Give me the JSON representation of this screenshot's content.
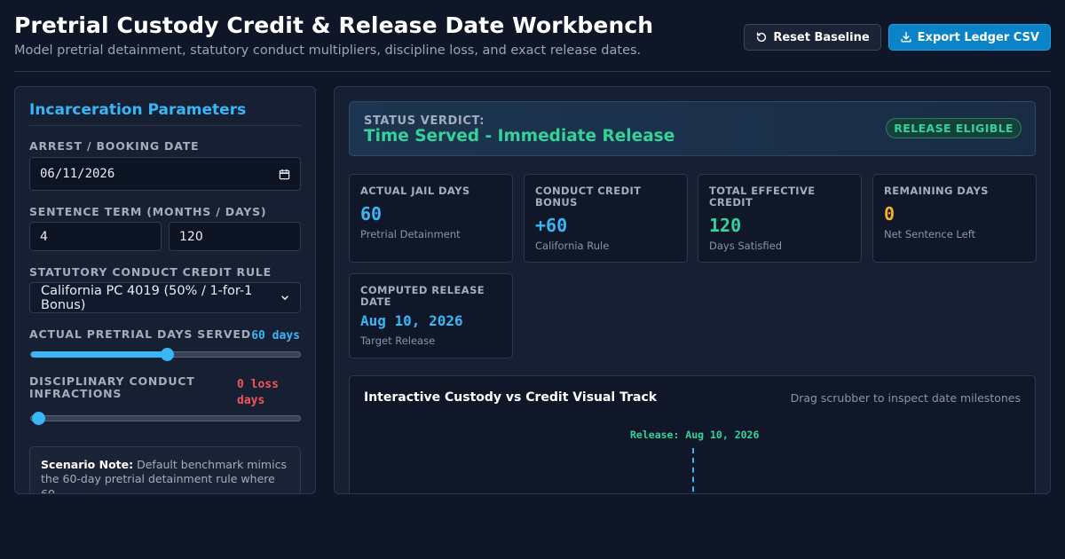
{
  "header": {
    "title": "Pretrial Custody Credit & Release Date Workbench",
    "subtitle": "Model pretrial detainment, statutory conduct multipliers, discipline loss, and exact release dates.",
    "reset_label": "Reset Baseline",
    "export_label": "Export Ledger CSV"
  },
  "params": {
    "title": "Incarceration Parameters",
    "arrest_label": "ARREST / BOOKING DATE",
    "arrest_value": "06/11/2026",
    "sentence_label": "SENTENCE TERM (MONTHS / DAYS)",
    "months_value": "4",
    "days_value": "120",
    "rule_label": "STATUTORY CONDUCT CREDIT RULE",
    "rule_value": "California PC 4019 (50% / 1-for-1 Bonus)",
    "pretrial_label": "ACTUAL PRETRIAL DAYS SERVED",
    "pretrial_value_text": "60 days",
    "pretrial_fraction": 0.5,
    "infractions_label": "DISCIPLINARY CONDUCT INFRACTIONS",
    "infractions_value_line1": "0 loss",
    "infractions_value_line2": "days",
    "infractions_fraction": 0.0,
    "note_bold": "Scenario Note:",
    "note_text": "Default benchmark mimics the 60-day pretrial detainment rule where 60"
  },
  "verdict": {
    "label": "STATUS VERDICT:",
    "text": "Time Served - Immediate Release",
    "badge": "RELEASE ELIGIBLE"
  },
  "cards": [
    {
      "label": "ACTUAL JAIL DAYS",
      "value": "60",
      "sub": "Pretrial Detainment",
      "color": "#38b6f5"
    },
    {
      "label": "CONDUCT CREDIT BONUS",
      "value": "+60",
      "sub": "California Rule",
      "color": "#38b6f5"
    },
    {
      "label": "TOTAL EFFECTIVE CREDIT",
      "value": "120",
      "sub": "Days Satisfied",
      "color": "#34d399"
    },
    {
      "label": "REMAINING DAYS",
      "value": "0",
      "sub": "Net Sentence Left",
      "color": "#f5b324"
    },
    {
      "label": "COMPUTED RELEASE DATE",
      "value": "Aug 10, 2026",
      "sub": "Target Release",
      "color": "#38b6f5"
    }
  ],
  "track": {
    "title": "Interactive Custody vs Credit Visual Track",
    "hint": "Drag scrubber to inspect date milestones",
    "release_label": "Release: Aug 10, 2026"
  },
  "colors": {
    "accent": "#38b6f5",
    "success": "#34d399",
    "warning": "#f5b324",
    "danger": "#f2555a"
  }
}
